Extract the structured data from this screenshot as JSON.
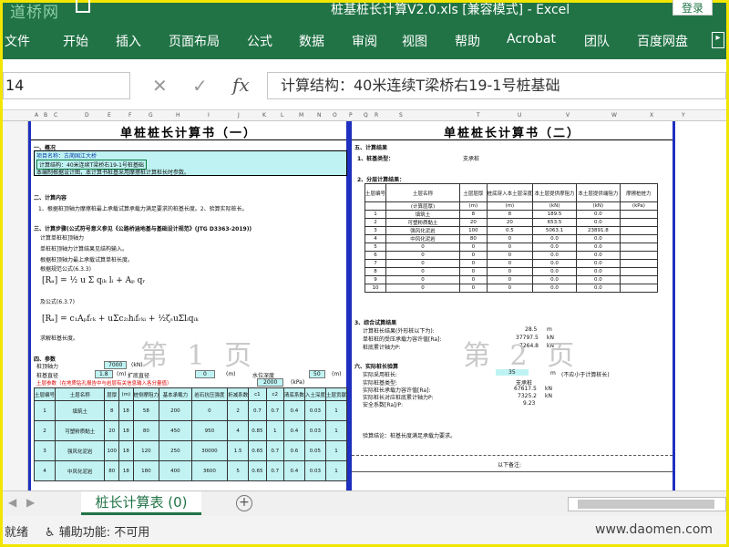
{
  "titlebar": {
    "logo": "道桥网",
    "title": "桩基桩长计算V2.0.xls [兼容模式] - Excel",
    "login": "登录"
  },
  "ribbon": {
    "tabs": [
      "文件",
      "开始",
      "插入",
      "页面布局",
      "公式",
      "数据",
      "审阅",
      "视图",
      "帮助",
      "Acrobat",
      "团队",
      "百度网盘"
    ]
  },
  "formula_bar": {
    "name_box": "14",
    "formula": "计算结构：40米连续T梁桥右19-1号桩基础"
  },
  "column_headers_left": [
    "A",
    "B",
    "C",
    "D",
    "E",
    "F",
    "G",
    "H",
    "I",
    "J",
    "K",
    "L",
    "M",
    "N",
    "O",
    "P"
  ],
  "column_headers_right": [
    "Q",
    "R",
    "S",
    "T",
    "U",
    "V",
    "W",
    "X",
    "Y",
    "Z"
  ],
  "page1": {
    "title": "单桩桩长计算书（一）",
    "s1": "一、概况",
    "s1_lines": [
      "项目名称：古蔺国江大桥",
      "计算结构：40米连续T梁桥右19-1号桩基础",
      "本编制根据设计图，本计算书桩基采用摩擦桩计算桩长时参数。"
    ],
    "s2": "二、计算内容",
    "s2_line": "1、根据桩顶轴力摩擦桩最上承载试算承载力满足要求的桩基长度。2、验算实际桩长。",
    "s3": "三、计算步骤(公式符号意义参见《公路桥涵地基与基础设计规范》(JTG D3363-2019))",
    "s3_lines": [
      "计算单桩桩顶轴力",
      "单桩桩顶轴力计算结果见结构输入。",
      "根据桩顶轴力最上承载试算单桩长度。",
      "根据规范公式(6.3.3)"
    ],
    "formula1": "[Rₐ] = ½ u Σ qᵢₖ lᵢ + Aₚ qᵣ",
    "also": "及公式(6.3.7)",
    "formula2": "[Rₐ] = c₁Aₚfᵣₖ + uΣc₂ᵢhᵢfᵣₖᵢ + ½ζₛuΣlᵢqᵢₖ",
    "solve": "求解桩基长度。",
    "s4": "四、参数",
    "p_axial_label": "桩顶轴力",
    "p_axial_val": "7000",
    "p_axial_unit": "(kN)",
    "p_dia_label": "桩基直径",
    "p_dia_val": "1.8",
    "p_dia_unit": "(m)",
    "p_exp_label": "扩底直径",
    "p_exp_val": "0",
    "p_exp_unit": "(m)",
    "p_water_label": "水位深度",
    "p_water_val": "50",
    "p_water_unit": "(m)",
    "p_fa_val": "2000",
    "p_fa_unit": "(kPa)",
    "warn": "土层参数（在地质钻孔报告中与岩层有关信息输入各分量值）",
    "table_headers": [
      "土层编号",
      "土层名称",
      "层厚",
      "(m)",
      "桩侧摩阻力",
      "基本承载力",
      "岩石抗压强度",
      "折减系数",
      "c1",
      "c2",
      "清底系数",
      "入土深度",
      "土层贡献"
    ],
    "rows": [
      [
        "1",
        "填筑土",
        "8",
        "18",
        "58",
        "200",
        "0",
        "2",
        "0.7",
        "0.7",
        "0.4",
        "0.03",
        "1"
      ],
      [
        "2",
        "可塑粉质黏土",
        "20",
        "18",
        "80",
        "450",
        "950",
        "4",
        "0.85",
        "1",
        "0.4",
        "0.03",
        "1"
      ],
      [
        "3",
        "强风化泥岩",
        "100",
        "18",
        "120",
        "250",
        "30000",
        "1.5",
        "0.65",
        "0.7",
        "0.6",
        "0.05",
        "1"
      ],
      [
        "4",
        "中风化泥岩",
        "80",
        "18",
        "180",
        "400",
        "3600",
        "5",
        "0.65",
        "0.7",
        "0.4",
        "0.03",
        "1"
      ]
    ],
    "watermark": "第 1 页"
  },
  "page2": {
    "title": "单桩桩长计算书（二）",
    "s5": "五、计算结果",
    "s5_1": "1、桩基类型：",
    "s5_1v": "支承桩",
    "s5_2": "2、分层计算结果：",
    "table_headers": [
      "土层编号",
      "土层名称",
      "土层层厚",
      "桩底穿入本土层深度",
      "本土层提供摩阻力",
      "本土层提供端阻力",
      "摩擦桩桩力"
    ],
    "units": [
      "",
      "(计算层厚)",
      "(m)",
      "(m)",
      "(kN)",
      "(kN)",
      "(kPa)"
    ],
    "rows": [
      [
        "1",
        "填筑土",
        "8",
        "8",
        "189.5",
        "0.0",
        ""
      ],
      [
        "2",
        "可塑粉质黏土",
        "20",
        "20",
        "653.5",
        "0.0",
        ""
      ],
      [
        "3",
        "强风化泥岩",
        "100",
        "0.5",
        "5063.1",
        "23891.8",
        ""
      ],
      [
        "4",
        "中风化泥岩",
        "80",
        "0",
        "0.0",
        "0.0",
        ""
      ],
      [
        "5",
        "0",
        "0",
        "0",
        "0.0",
        "0.0",
        ""
      ],
      [
        "6",
        "0",
        "0",
        "0",
        "0.0",
        "0.0",
        ""
      ],
      [
        "7",
        "0",
        "0",
        "0",
        "0.0",
        "0.0",
        ""
      ],
      [
        "8",
        "0",
        "0",
        "0",
        "0.0",
        "0.0",
        ""
      ],
      [
        "9",
        "0",
        "0",
        "0",
        "0.0",
        "0.0",
        ""
      ],
      [
        "10",
        "0",
        "0",
        "0",
        "0.0",
        "0.0",
        ""
      ]
    ],
    "s3": "3、综合试算结果",
    "s3_lines": [
      "计算桩长结果(外形桩以下为):",
      "单桩桩的受压承载力容许值[Ra]:",
      "桩底累计轴力P:"
    ],
    "s3_vals": [
      "28.5",
      "37797.5",
      "7264.8"
    ],
    "s3_units": [
      "m",
      "kN",
      "kN"
    ],
    "s6": "六、实际桩长验算",
    "s6_lines": [
      "实际采用桩长:",
      "实际桩基类型:",
      "实际桩长承载力容许值[Ra]:",
      "实际桩长对应桩底累计轴力P:",
      "安全系数[Ra]/P:"
    ],
    "s6_vals": [
      "35",
      "支承桩",
      "67617.5",
      "7325.2",
      "9.23"
    ],
    "s6_units": [
      "m",
      "",
      "kN",
      "kN",
      ""
    ],
    "s6_note": "(不应小于计算桩长)",
    "conclusion": "验算结论：桩基长度满足承载力要求。",
    "below": "以下备注:",
    "watermark": "第 2 页"
  },
  "sheet_tab": {
    "name": "桩长计算表 (0)"
  },
  "status": {
    "ready": "就绪",
    "accessibility": "辅助功能: 不可用",
    "watermark": "www.daomen.com"
  },
  "colors": {
    "excel_green": "#217346",
    "page_border": "#1f2fbf",
    "cyan": "#bff3f3",
    "frame": "#f2e600"
  }
}
